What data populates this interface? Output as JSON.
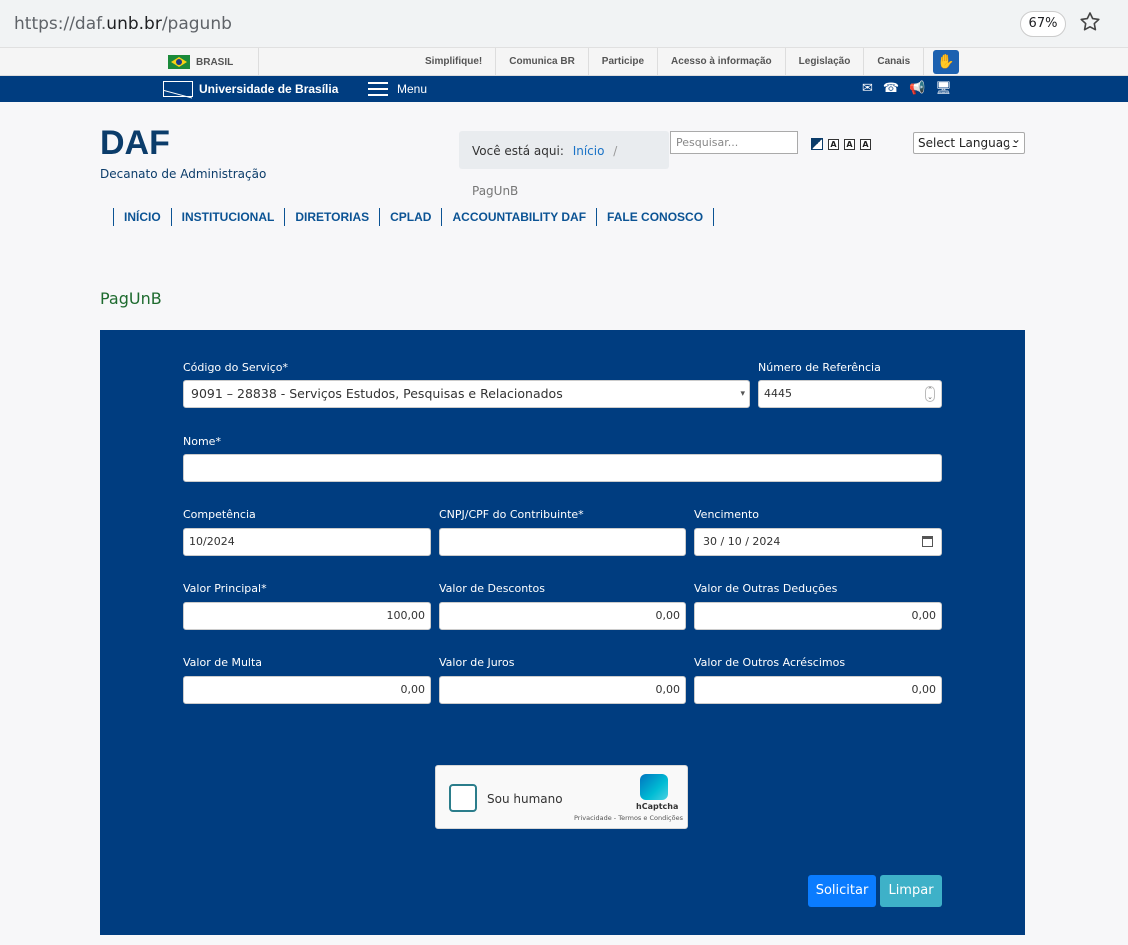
{
  "browser": {
    "url_prefix": "https://daf.",
    "url_domain": "unb.br",
    "url_path": "/pagunb",
    "zoom": "67%"
  },
  "govbar": {
    "country": "BRASIL",
    "links": [
      "Simplifique!",
      "Comunica BR",
      "Participe",
      "Acesso à informação",
      "Legislação",
      "Canais"
    ]
  },
  "unbbar": {
    "name": "Universidade de Brasília",
    "menu_label": "Menu"
  },
  "header": {
    "title": "DAF",
    "subtitle": "Decanato de Administração",
    "breadcrumb_prefix": "Você está aqui:",
    "breadcrumb_home": "Início",
    "breadcrumb_current": "PagUnB",
    "search_placeholder": "Pesquisar...",
    "font_size_labels": [
      "A",
      "A",
      "A"
    ],
    "language_select": "Select Language"
  },
  "nav": [
    "INÍCIO",
    "INSTITUCIONAL",
    "DIRETORIAS",
    "CPLAD",
    "ACCOUNTABILITY DAF",
    "FALE CONOSCO"
  ],
  "page_heading": "PagUnB",
  "form": {
    "servico_label": "Código do Serviço*",
    "servico_value": "9091 – 28838 - Serviços Estudos, Pesquisas e Relacionados",
    "referencia_label": "Número de Referência",
    "referencia_value": "4445",
    "nome_label": "Nome*",
    "nome_value": "",
    "competencia_label": "Competência",
    "competencia_value": "10/2024",
    "cnpj_label": "CNPJ/CPF do Contribuinte*",
    "cnpj_value": "",
    "vencimento_label": "Vencimento",
    "vencimento_value": "30 / 10 / 2024",
    "principal_label": "Valor Principal*",
    "principal_value": "100,00",
    "descontos_label": "Valor de Descontos",
    "descontos_value": "0,00",
    "deducoes_label": "Valor de Outras Deduções",
    "deducoes_value": "0,00",
    "multa_label": "Valor de Multa",
    "multa_value": "0,00",
    "juros_label": "Valor de Juros",
    "juros_value": "0,00",
    "acrescimos_label": "Valor de Outros Acréscimos",
    "acrescimos_value": "0,00"
  },
  "captcha": {
    "label": "Sou humano",
    "brand": "hCaptcha",
    "terms": "Privacidade - Termos e Condições"
  },
  "buttons": {
    "submit": "Solicitar",
    "clear": "Limpar"
  }
}
